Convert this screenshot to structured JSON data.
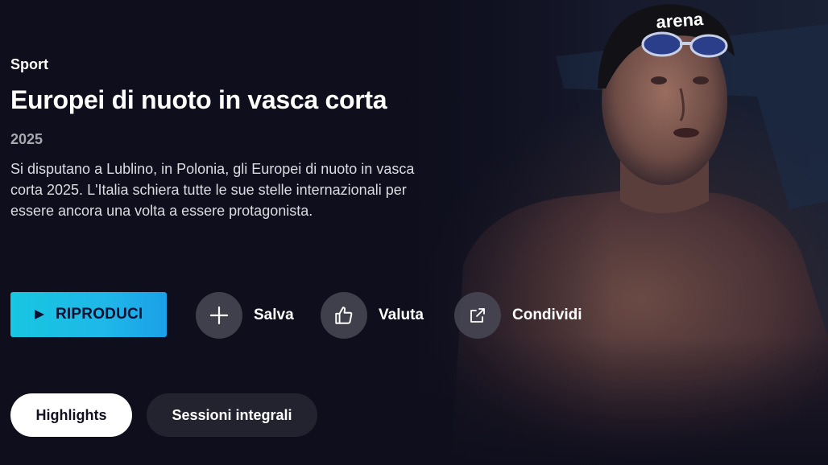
{
  "hero": {
    "category": "Sport",
    "title": "Europei di nuoto in vasca corta",
    "year": "2025",
    "description": "Si disputano a Lublino, in Polonia, gli Europei di nuoto in vasca corta 2025. L'Italia schiera tutte le sue stelle internazionali per essere ancora una volta a essere protagonista.",
    "image_caption": "arena"
  },
  "actions": {
    "play_label": "RIPRODUCI",
    "save_label": "Salva",
    "rate_label": "Valuta",
    "share_label": "Condividi"
  },
  "tabs": [
    {
      "label": "Highlights",
      "active": true
    },
    {
      "label": "Sessioni integrali",
      "active": false
    }
  ],
  "colors": {
    "background": "#0f0f1e",
    "accent": "#17c6e0",
    "action_circle": "#46464f"
  },
  "icons": [
    "play-icon",
    "plus-icon",
    "thumbs-up-icon",
    "share-icon"
  ]
}
